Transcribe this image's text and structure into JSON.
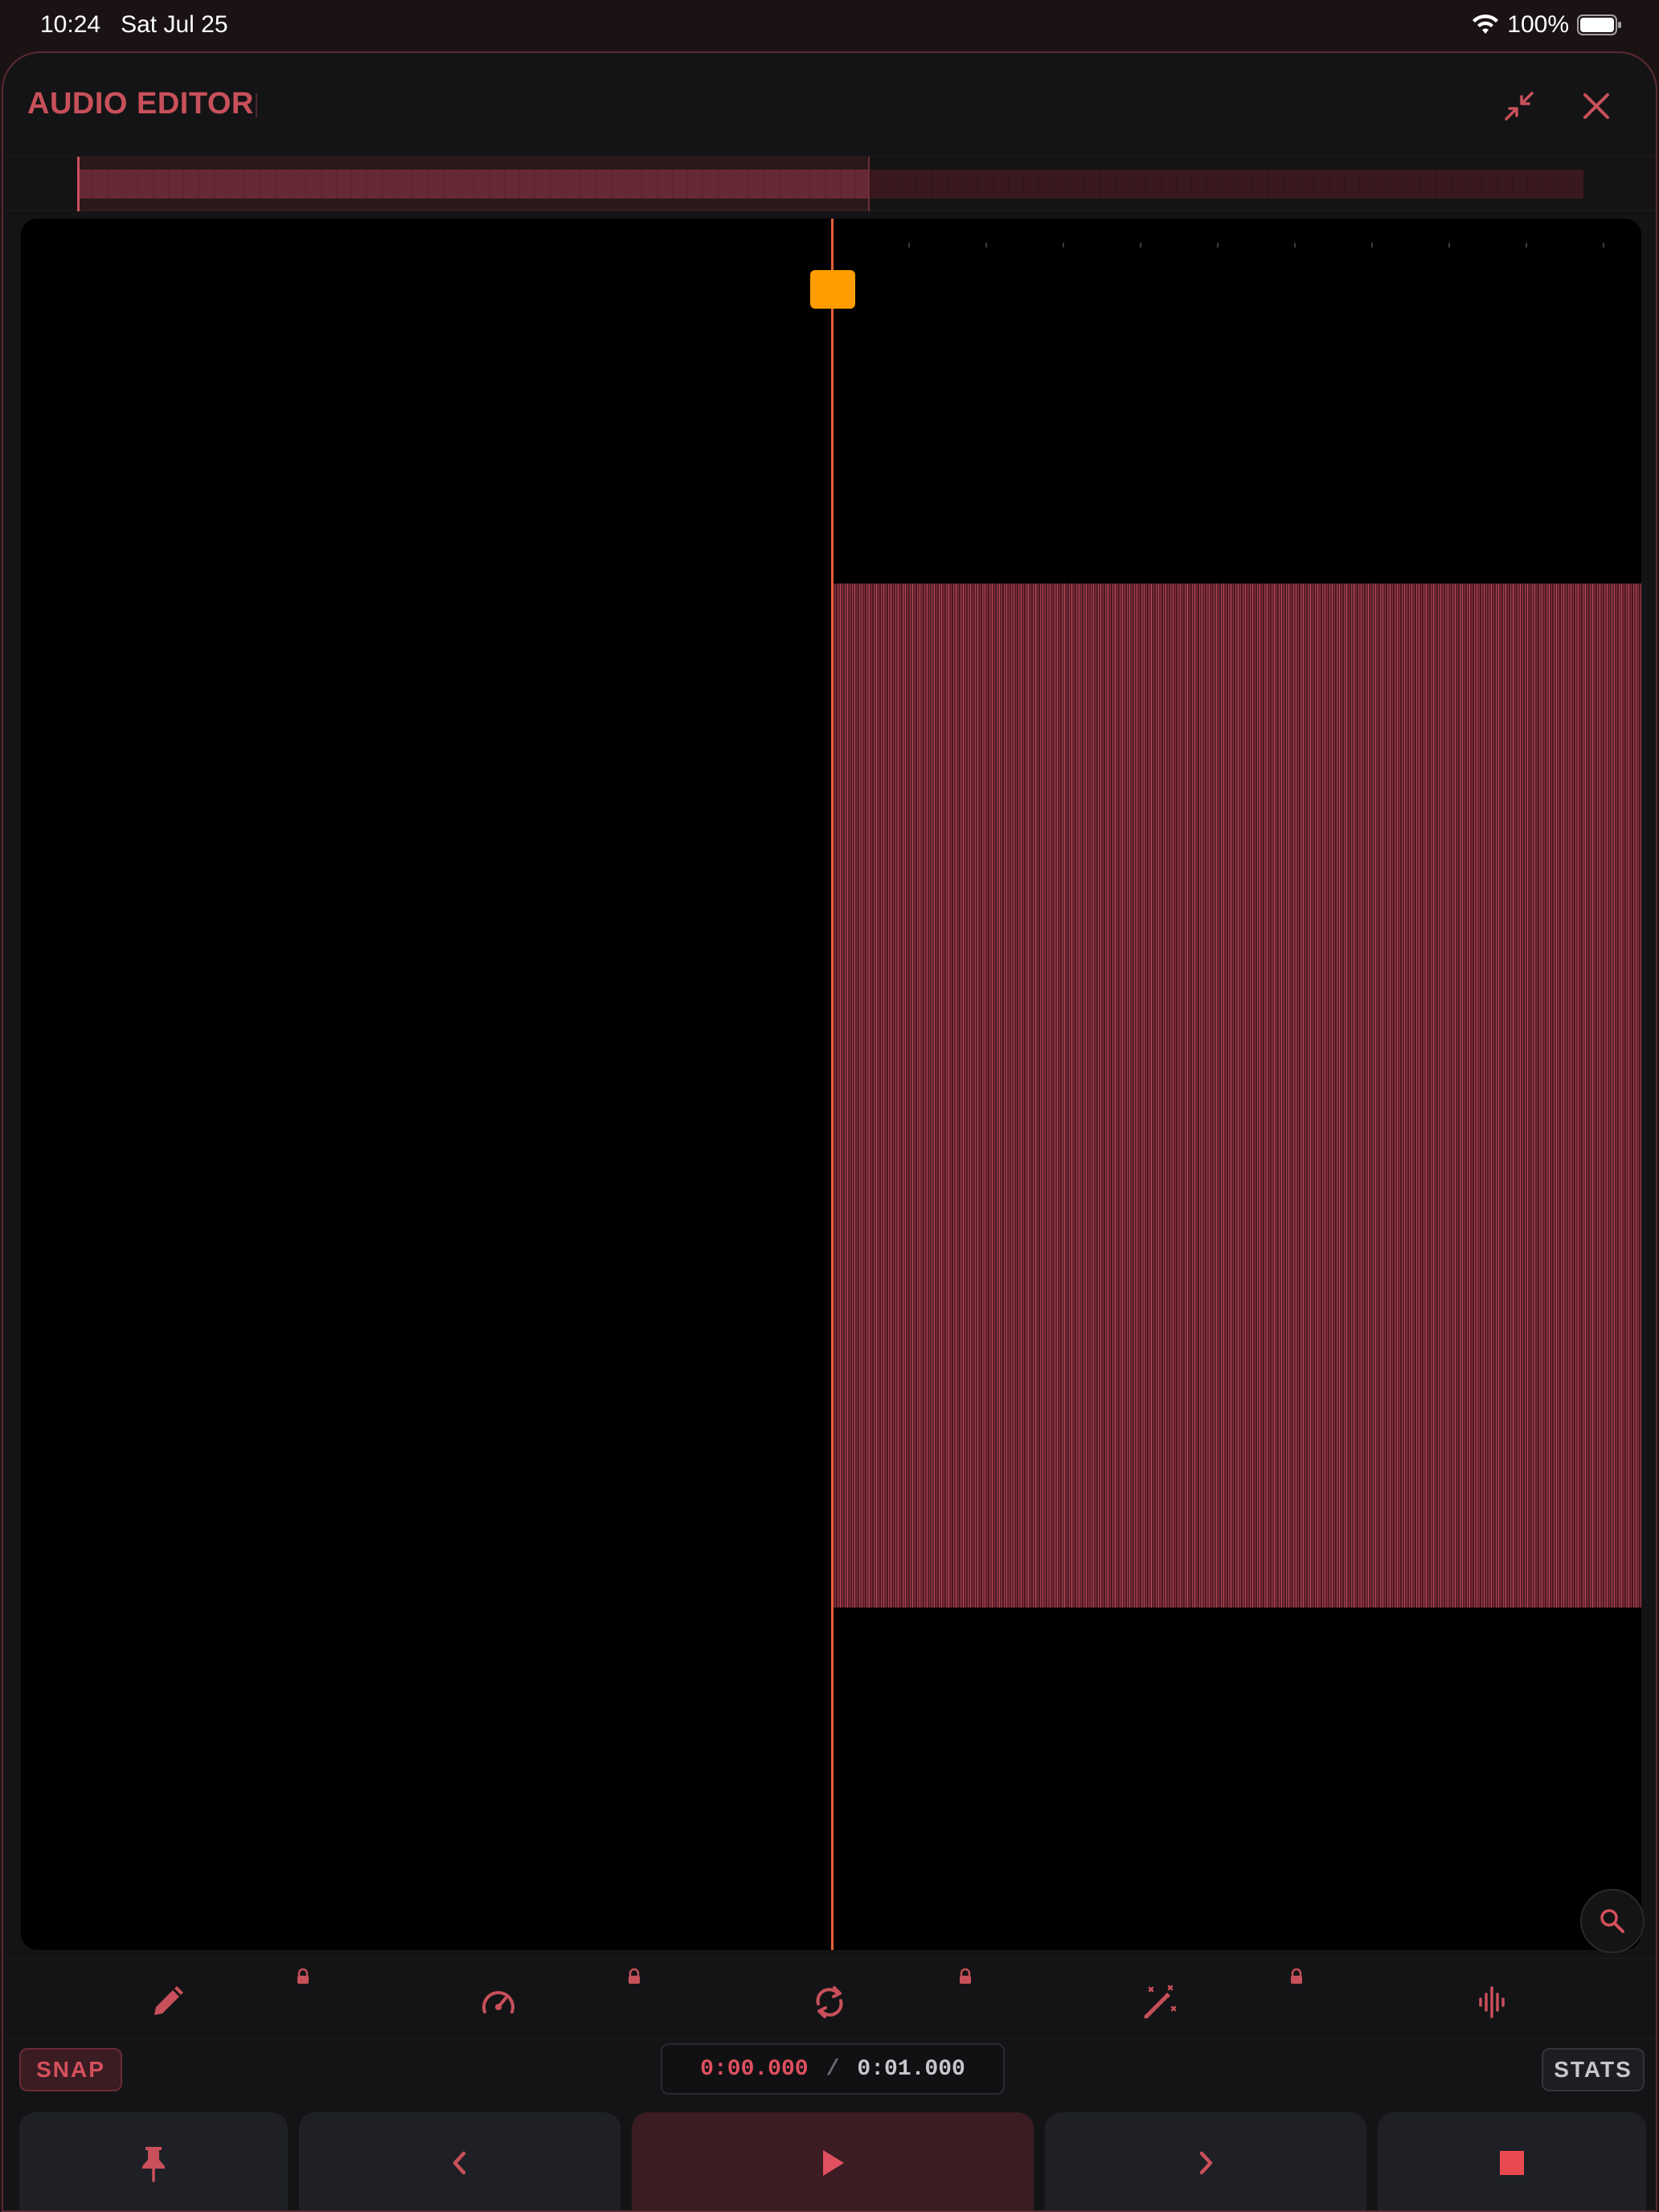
{
  "status_bar": {
    "time": "10:24",
    "date": "Sat Jul 25",
    "battery": "100%"
  },
  "window": {
    "title": "AUDIO EDITOR",
    "accent_color": "#c8505a",
    "playhead_color": "#ff9d00"
  },
  "icons": {
    "minimize": "minimize-icon",
    "close": "close-icon",
    "zoom": "search-icon",
    "tools": [
      "pencil-icon",
      "speedometer-icon",
      "loop-icon",
      "magic-wand-icon",
      "waveform-icon"
    ],
    "transport": [
      "pin-icon",
      "chevron-left-icon",
      "play-icon",
      "chevron-right-icon",
      "stop-icon"
    ]
  },
  "controls": {
    "snap_label": "SNAP",
    "stats_label": "STATS",
    "time_current": "0:00.000",
    "time_separator": "/",
    "time_total": "0:01.000"
  }
}
